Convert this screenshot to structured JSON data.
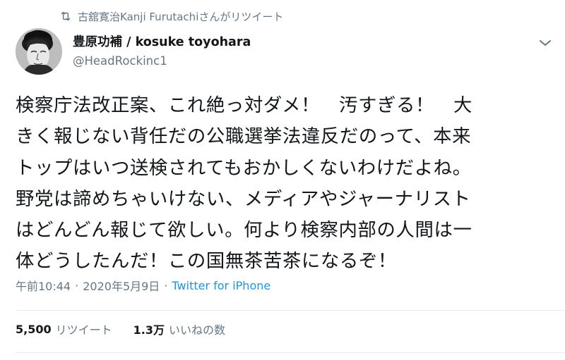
{
  "retweet_context": {
    "text": "古舘寛治Kanji Furutachiさんがリツイート",
    "icon": "retweet-icon"
  },
  "author": {
    "display_name": "豊原功補 / kosuke toyohara",
    "handle": "@HeadRockinc1",
    "avatar_icon": "avatar-portrait"
  },
  "tweet": {
    "lines": [
      "検察庁法改正案、これ絶っ対ダメ！　汚すぎる！　大",
      "きく報じない背任だの公職選挙法違反だのって、本来",
      "トップはいつ送検されてもおかしくないわけだよね。",
      "野党は諦めちゃいけない、メディアやジャーナリスト",
      "はどんどん報じて欲しい。何より検察内部の人間は一",
      "体どうしたんだ！この国無茶苦茶になるぞ！"
    ]
  },
  "meta": {
    "time": "午前10:44",
    "separator": "·",
    "date": "2020年5月9日",
    "source": "Twitter for iPhone"
  },
  "stats": {
    "retweets_count": "5,500",
    "retweets_label": "リツイート",
    "likes_count": "1.3万",
    "likes_label": "いいねの数"
  },
  "colors": {
    "text": "#14171a",
    "secondary": "#657786",
    "link": "#1b95e0",
    "divider": "#e6ecf0"
  }
}
